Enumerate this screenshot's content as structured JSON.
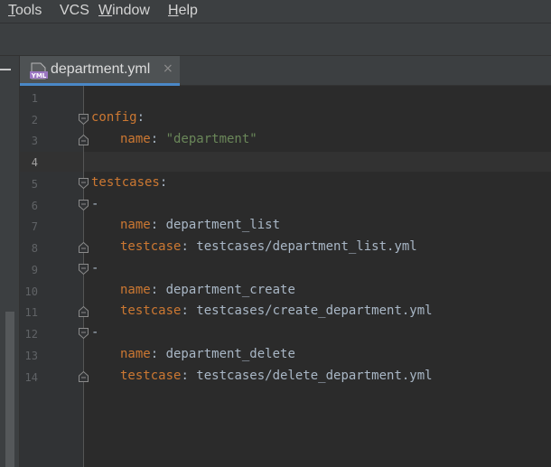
{
  "menu": {
    "items": [
      {
        "mnemonic": "T",
        "rest": "ools"
      },
      {
        "mnemonic": "",
        "rest": "VCS"
      },
      {
        "mnemonic": "W",
        "rest": "indow"
      },
      {
        "mnemonic": "H",
        "rest": "elp"
      }
    ]
  },
  "tab": {
    "filename": "department.yml",
    "icon_text": "YML",
    "close_glyph": "×"
  },
  "editor": {
    "lines": [
      {
        "num": "1"
      },
      {
        "num": "2",
        "key": "config",
        "sep": ":"
      },
      {
        "num": "3",
        "key": "name",
        "sep": ": ",
        "str": "\"department\""
      },
      {
        "num": "4"
      },
      {
        "num": "5",
        "key": "testcases",
        "sep": ":"
      },
      {
        "num": "6",
        "plain": "-"
      },
      {
        "num": "7",
        "key": "name",
        "sep": ": ",
        "value": "department_list"
      },
      {
        "num": "8",
        "key": "testcase",
        "sep": ": ",
        "value": "testcases/department_list.yml"
      },
      {
        "num": "9",
        "plain": "-"
      },
      {
        "num": "10",
        "key": "name",
        "sep": ": ",
        "value": "department_create"
      },
      {
        "num": "11",
        "key": "testcase",
        "sep": ": ",
        "value": "testcases/create_department.yml"
      },
      {
        "num": "12",
        "plain": "-"
      },
      {
        "num": "13",
        "key": "name",
        "sep": ": ",
        "value": "department_delete"
      },
      {
        "num": "14",
        "key": "testcase",
        "sep": ": ",
        "value": "testcases/delete_department.yml"
      }
    ],
    "current_line": "4"
  },
  "colors": {
    "keyword": "#cc7832",
    "string": "#6a8759",
    "text": "#a9b7c6",
    "tab_underline": "#4a88c7"
  }
}
